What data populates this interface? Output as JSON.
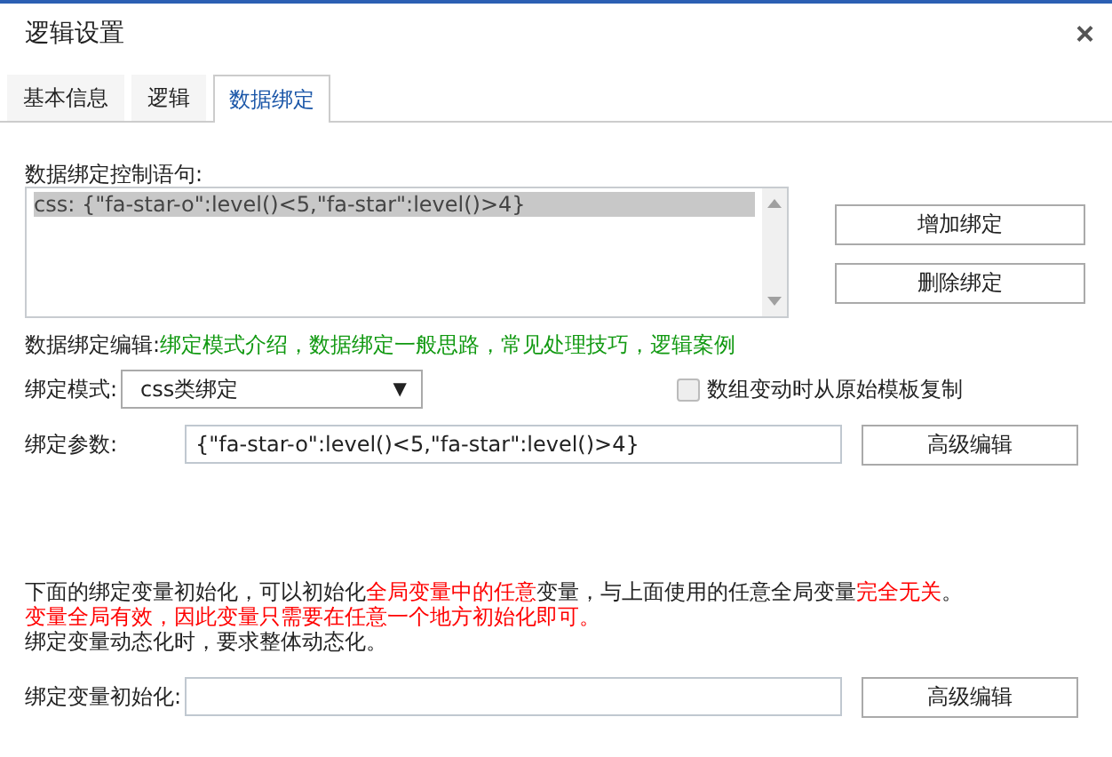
{
  "window": {
    "title": "逻辑设置",
    "close": "×"
  },
  "tabs": [
    {
      "label": "基本信息",
      "selected": false
    },
    {
      "label": "逻辑",
      "selected": false
    },
    {
      "label": "数据绑定",
      "selected": true
    }
  ],
  "statements": {
    "label": "数据绑定控制语句:",
    "items": [
      {
        "text": "css: {\"fa-star-o\":level()<5,\"fa-star\":level()>4}",
        "selected": true
      }
    ]
  },
  "buttons": [
    "增加绑定",
    "删除绑定"
  ],
  "help": {
    "label": "数据绑定编辑:",
    "links": [
      "绑定模式介绍",
      "数据绑定一般思路",
      "常见处理技巧",
      "逻辑案例"
    ],
    "separator": "，"
  },
  "mode": {
    "label": "绑定模式:",
    "value": "css类绑定",
    "arrow": "▼"
  },
  "copy_option": {
    "label": "数组变动时从原始模板复制",
    "checked": false,
    "disabled": true
  },
  "params": {
    "label": "绑定参数:",
    "value": "{\"fa-star-o\":level()<5,\"fa-star\":level()>4}",
    "button": "高级编辑"
  },
  "notes": [
    [
      {
        "text": "下面的绑定变量初始化，可以初始化",
        "highlight": false
      },
      {
        "text": "全局变量中的任意",
        "highlight": true
      },
      {
        "text": "变量，与上面使用的任意全局变量",
        "highlight": false
      },
      {
        "text": "完全无关",
        "highlight": true
      },
      {
        "text": "。",
        "highlight": false
      }
    ],
    [
      {
        "text": "变量全局有效，因此变量只需要在任意一个地方初始化即可。",
        "highlight": true
      }
    ],
    [
      {
        "text": "绑定变量动态化时，要求整体动态化。",
        "highlight": false
      }
    ]
  ],
  "init": {
    "label": "绑定变量初始化:",
    "button": "高级编辑"
  }
}
